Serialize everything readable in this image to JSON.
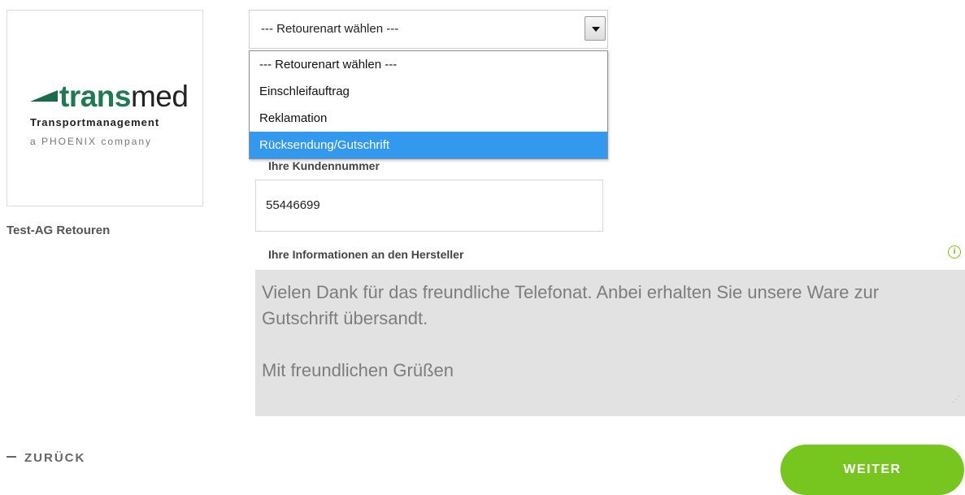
{
  "logo": {
    "brand_part1": "trans",
    "brand_part2": "med",
    "subtitle": "Transportmanagement",
    "tagline": "a PHOENIX company"
  },
  "company_name": "Test-AG Retouren",
  "return_type": {
    "selected": "--- Retourenart wählen ---",
    "options": [
      "--- Retourenart wählen ---",
      "Einschleifauftrag",
      "Reklamation",
      "Rücksendung/Gutschrift"
    ],
    "highlighted_index": 3
  },
  "customer_number": {
    "label": "Ihre Kundennummer",
    "value": "55446699"
  },
  "manufacturer_info": {
    "label": "Ihre Informationen an den Hersteller",
    "value": "Vielen Dank für das freundliche Telefonat. Anbei erhalten Sie unsere Ware zur Gutschrift übersandt.\n\nMit freundlichen Grüßen"
  },
  "nav": {
    "back_label": "ZURÜCK",
    "next_label": "WEITER"
  },
  "colors": {
    "brand_green": "#1e7a50",
    "accent_green": "#76c61f",
    "highlight_blue": "#3399ee",
    "textarea_bg": "#e2e2e2"
  },
  "icons": {
    "info": "info-circle-icon",
    "dropdown": "chevron-down-icon"
  }
}
